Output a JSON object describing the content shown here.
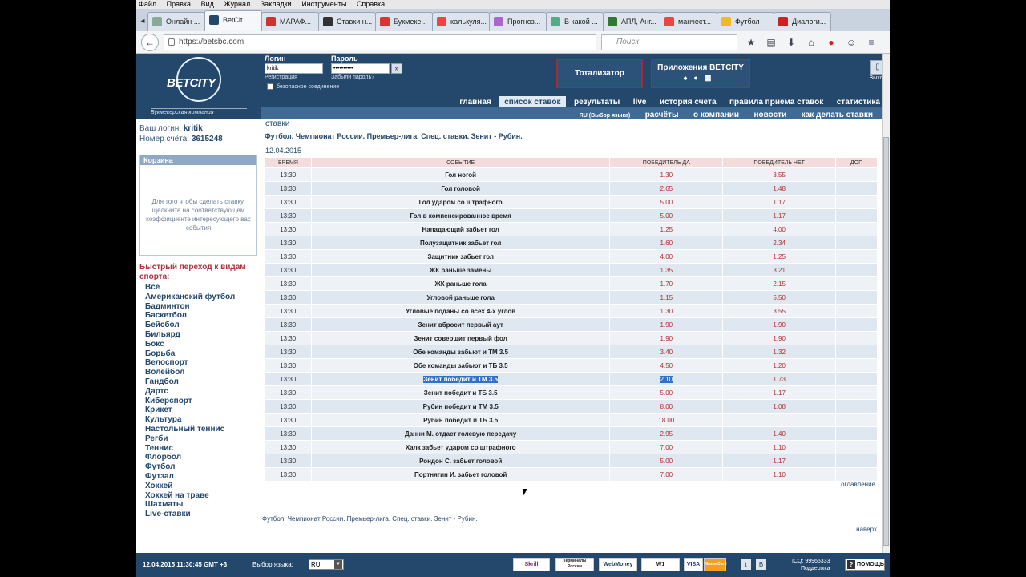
{
  "browser": {
    "menu": [
      "Файл",
      "Правка",
      "Вид",
      "Журнал",
      "Закладки",
      "Инструменты",
      "Справка"
    ],
    "tabs": [
      "Онлайн ...",
      "BetCit...",
      "МАРАФ...",
      "Ставки н...",
      "Букмеке...",
      "калькуля...",
      "Прогноз...",
      "В какой ...",
      "АПЛ, Анг...",
      "манчест...",
      "Футбол",
      "Диалоги..."
    ],
    "url": "https://betsbc.com",
    "search_placeholder": "Поиск"
  },
  "header": {
    "logo_text": "BETCITY",
    "logo_sub": "Букмекерская компания",
    "login_label": "Логин",
    "password_label": "Пароль",
    "login_value": "kritik",
    "password_value": "••••••••••",
    "go": "»",
    "register": "Регистрация",
    "forgot": "Забыли пароль?",
    "secure": "безопасное соединение",
    "totalizator": "Тотализатор",
    "apps": "Приложения BETCITY",
    "exit": "Выход"
  },
  "menu_top": [
    "главная",
    "список ставок",
    "результаты",
    "live",
    "история счёта",
    "правила приёма ставок",
    "статистика"
  ],
  "menu_bottom": {
    "lang": "RU (Выбор языка)",
    "items": [
      "расчёты",
      "о компании",
      "новости",
      "как делать ставки"
    ]
  },
  "account": {
    "login_label": "Ваш логин:",
    "login": "kritik",
    "account_label": "Номер счёта:",
    "account": "3615248"
  },
  "cart": {
    "title": "Корзина",
    "text": "Для того чтобы сделать ставку, щелкните на соответствующем коэффициенте интересующего вас события"
  },
  "sports_title": "Быстрый переход к видам спорта:",
  "sports": [
    "Все",
    "Американский футбол",
    "Бадминтон",
    "Баскетбол",
    "Бейсбол",
    "Бильярд",
    "Бокс",
    "Борьба",
    "Велоспорт",
    "Волейбол",
    "Гандбол",
    "Дартс",
    "Киберспорт",
    "Крикет",
    "Культура",
    "Настольный теннис",
    "Регби",
    "Теннис",
    "Флорбол",
    "Футбол",
    "Футзал",
    "Хоккей",
    "Хоккей на траве",
    "Шахматы",
    "Live-ставки"
  ],
  "main": {
    "top": "ставки",
    "breadcrumb": "Футбол. Чемпионат России. Премьер-лига. Спец. ставки. Зенит - Рубин.",
    "date": "12.04.2015",
    "columns": [
      "ВРЕМЯ",
      "СОБЫТИЕ",
      "ПОБЕДИТЕЛЬ ДА",
      "ПОБЕДИТЕЛЬ НЕТ",
      "ДОП"
    ],
    "rows": [
      {
        "time": "13:30",
        "event": "Гол ногой",
        "yes": "1.30",
        "no": "3.55"
      },
      {
        "time": "13:30",
        "event": "Гол головой",
        "yes": "2.65",
        "no": "1.48"
      },
      {
        "time": "13:30",
        "event": "Гол ударом со штрафного",
        "yes": "5.00",
        "no": "1.17"
      },
      {
        "time": "13:30",
        "event": "Гол в компенсированное время",
        "yes": "5.00",
        "no": "1.17"
      },
      {
        "time": "13:30",
        "event": "Нападающий забьет гол",
        "yes": "1.25",
        "no": "4.00"
      },
      {
        "time": "13:30",
        "event": "Полузащитник забьет гол",
        "yes": "1.60",
        "no": "2.34"
      },
      {
        "time": "13:30",
        "event": "Защитник забьет гол",
        "yes": "4.00",
        "no": "1.25"
      },
      {
        "time": "13:30",
        "event": "ЖК раньше замены",
        "yes": "1.35",
        "no": "3.21"
      },
      {
        "time": "13:30",
        "event": "ЖК раньше гола",
        "yes": "1.70",
        "no": "2.15"
      },
      {
        "time": "13:30",
        "event": "Угловой раньше гола",
        "yes": "1.15",
        "no": "5.50"
      },
      {
        "time": "13:30",
        "event": "Угловые поданы со всех 4-х углов",
        "yes": "1.30",
        "no": "3.55"
      },
      {
        "time": "13:30",
        "event": "Зенит вбросит первый аут",
        "yes": "1.90",
        "no": "1.90"
      },
      {
        "time": "13:30",
        "event": "Зенит совершит первый фол",
        "yes": "1.90",
        "no": "1.90"
      },
      {
        "time": "13:30",
        "event": "Обе команды забьют и ТМ 3.5",
        "yes": "3.40",
        "no": "1.32"
      },
      {
        "time": "13:30",
        "event": "Обе команды забьют и ТБ 3.5",
        "yes": "4.50",
        "no": "1.20"
      },
      {
        "time": "13:30",
        "event": "Зенит победит и ТМ 3.5",
        "yes": "2.10",
        "no": "1.73",
        "selected": true
      },
      {
        "time": "13:30",
        "event": "Зенит победит и ТБ 3.5",
        "yes": "5.00",
        "no": "1.17"
      },
      {
        "time": "13:30",
        "event": "Рубин победит и ТМ 3.5",
        "yes": "8.00",
        "no": "1.08"
      },
      {
        "time": "13:30",
        "event": "Рубин победит и ТБ 3.5",
        "yes": "18.00",
        "no": ""
      },
      {
        "time": "13:30",
        "event": "Данни М. отдаст голевую передачу",
        "yes": "2.95",
        "no": "1.40"
      },
      {
        "time": "13:30",
        "event": "Халк забьет ударом со штрафного",
        "yes": "7.00",
        "no": "1.10"
      },
      {
        "time": "13:30",
        "event": "Рондон С. забьет головой",
        "yes": "5.00",
        "no": "1.17"
      },
      {
        "time": "13:30",
        "event": "Портнягин И. забьет головой",
        "yes": "7.00",
        "no": "1.10"
      }
    ],
    "toc": "оглавление",
    "breadcrumb_bottom": "Футбол. Чемпионат России. Премьер-лига. Спец. ставки. Зенит - Рубин.",
    "up": "наверх"
  },
  "footer": {
    "datetime": "12.04.2015  11:30:45  GMT +3",
    "lang_label": "Выбор языка:",
    "lang": "RU",
    "payments": [
      "Skrill",
      "Терминалы России",
      "WebMoney",
      "W1",
      "VISA",
      "MasterCard"
    ],
    "social": [
      "t",
      "В"
    ],
    "icq": "ICQ: 99965333",
    "support": "Поддержка",
    "help": "ПОМОЩЬ"
  },
  "colors": {
    "brand_dark": "#24486b",
    "brand_mid": "#3f6a94",
    "odds": "#b03030",
    "selection": "#3370c8"
  }
}
